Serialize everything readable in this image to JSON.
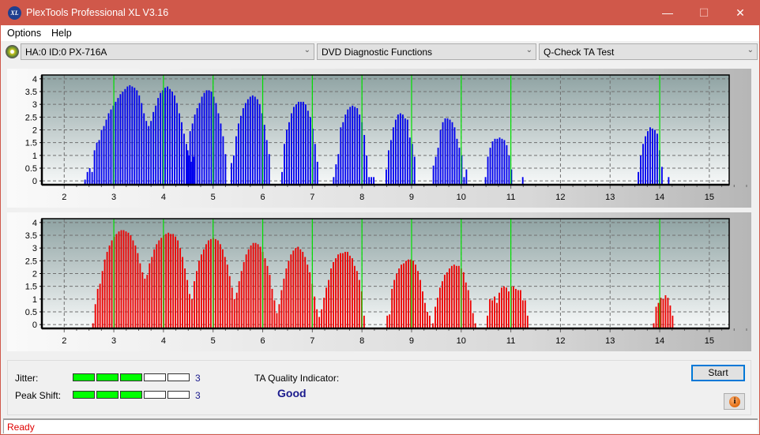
{
  "window": {
    "title": "PlexTools Professional XL V3.16",
    "logo_text": "XL",
    "controls": {
      "minimize": "—",
      "maximize": "☐",
      "close": "✕"
    }
  },
  "menu": {
    "items": [
      "Options",
      "Help"
    ]
  },
  "toolbar": {
    "drive_select": "HA:0 ID:0  PX-716A",
    "function_select": "DVD Diagnostic Functions",
    "test_select": "Q-Check TA Test"
  },
  "colors": {
    "titlebar": "#d0584a",
    "top_bars": "#0000ee",
    "bottom_bars": "#ee0000",
    "green_lines": "#00e000",
    "meter_on": "#00ff00",
    "indicator_text": "#1a1a8c",
    "status_text": "#e00000"
  },
  "chart_data": [
    {
      "name": "top-chart",
      "type": "bar",
      "xlim": [
        1.55,
        15.4
      ],
      "ylim": [
        -0.15,
        4.15
      ],
      "xticks": [
        2,
        3,
        4,
        5,
        6,
        7,
        8,
        9,
        10,
        11,
        12,
        13,
        14,
        15
      ],
      "yticks": [
        0,
        0.5,
        1,
        1.5,
        2,
        2.5,
        3,
        3.5,
        4
      ],
      "ytick_labels": [
        "0",
        "0.5",
        "1",
        "1.5",
        "2",
        "2.5",
        "3",
        "3.5",
        "4"
      ],
      "green_lines": [
        3,
        4,
        5,
        6,
        7,
        8,
        9,
        10,
        11,
        14
      ],
      "grid": true,
      "bar_color": "#0000ee",
      "bar_step": 0.0475,
      "peaks": [
        {
          "start": 2.42,
          "values": [
            0.05,
            0.35,
            0.5,
            0.35,
            1.2,
            1.5,
            1.6,
            2.0,
            2.15,
            2.4,
            2.65,
            2.8,
            2.95,
            3.1,
            3.25,
            3.4,
            3.5,
            3.6,
            3.7,
            3.75,
            3.7,
            3.65,
            3.55,
            3.35,
            3.05,
            2.65,
            2.35,
            2.15,
            2.35,
            2.7,
            2.95,
            3.25,
            3.45,
            3.55,
            3.65,
            3.7,
            3.6,
            3.5,
            3.35,
            3.05,
            2.65,
            2.3,
            1.85,
            1.45,
            1.0,
            0.75,
            0.95
          ]
        },
        {
          "start": 4.49,
          "values": [
            1.2,
            1.95,
            2.25,
            2.6,
            2.85,
            3.05,
            3.3,
            3.45,
            3.55,
            3.55,
            3.5,
            3.3,
            3.05,
            2.65,
            2.25,
            1.75,
            1.05
          ]
        },
        {
          "start": 5.37,
          "values": [
            0.7,
            1.0,
            1.75,
            2.25,
            2.55,
            2.85,
            3.05,
            3.2,
            3.3,
            3.35,
            3.3,
            3.2,
            3.0,
            2.65,
            2.2,
            1.6,
            1.05
          ]
        },
        {
          "start": 6.39,
          "values": [
            0.35,
            1.45,
            2.0,
            2.3,
            2.65,
            2.9,
            3.0,
            3.1,
            3.1,
            3.1,
            3.0,
            2.75,
            2.5,
            2.05,
            1.45,
            0.75
          ]
        },
        {
          "start": 7.43,
          "values": [
            0.15,
            0.65,
            1.05,
            2.1,
            2.3,
            2.6,
            2.8,
            2.9,
            2.95,
            2.9,
            2.85,
            2.6,
            2.3,
            1.8,
            1.0,
            0.15,
            0.15,
            0.15
          ]
        },
        {
          "start": 8.49,
          "values": [
            0.45,
            1.2,
            1.6,
            2.1,
            2.4,
            2.6,
            2.65,
            2.6,
            2.45,
            2.4,
            1.7,
            1.45,
            0.95
          ]
        },
        {
          "start": 9.44,
          "values": [
            0.6,
            0.95,
            1.3,
            2.0,
            2.3,
            2.45,
            2.45,
            2.4,
            2.3,
            2.1,
            1.65,
            1.3,
            1.0,
            0.15,
            0.45
          ]
        },
        {
          "start": 10.49,
          "values": [
            0.15,
            0.95,
            1.3,
            1.55,
            1.65,
            1.65,
            1.7,
            1.65,
            1.6,
            1.4,
            1.0,
            0.45
          ]
        },
        {
          "start": 11.24,
          "values": [
            0.15
          ]
        },
        {
          "start": 13.57,
          "values": [
            0.35,
            1.0,
            1.45,
            1.75,
            1.95,
            2.1,
            2.05,
            2.0,
            1.85,
            1.2,
            0.55
          ]
        },
        {
          "start": 14.18,
          "values": [
            0.15
          ]
        }
      ]
    },
    {
      "name": "bottom-chart",
      "type": "bar",
      "xlim": [
        1.55,
        15.4
      ],
      "ylim": [
        -0.15,
        4.15
      ],
      "xticks": [
        2,
        3,
        4,
        5,
        6,
        7,
        8,
        9,
        10,
        11,
        12,
        13,
        14,
        15
      ],
      "yticks": [
        0,
        0.5,
        1,
        1.5,
        2,
        2.5,
        3,
        3.5,
        4
      ],
      "ytick_labels": [
        "0",
        "0.5",
        "1",
        "1.5",
        "2",
        "2.5",
        "3",
        "3.5",
        "4"
      ],
      "green_lines": [
        3,
        4,
        5,
        6,
        7,
        8,
        9,
        10,
        11,
        14
      ],
      "grid": true,
      "bar_color": "#ee0000",
      "bar_step": 0.0475,
      "peaks": [
        {
          "start": 2.58,
          "values": [
            0.05,
            0.8,
            1.4,
            1.6,
            2.1,
            2.55,
            2.85,
            3.1,
            3.3,
            3.45,
            3.55,
            3.65,
            3.7,
            3.7,
            3.65,
            3.6,
            3.5,
            3.3,
            3.1,
            2.8,
            2.4,
            2.05,
            1.8,
            1.95,
            2.4,
            2.65,
            2.95,
            3.15,
            3.3,
            3.4,
            3.5,
            3.55,
            3.6,
            3.55,
            3.55,
            3.45,
            3.3,
            3.0,
            2.65,
            2.2,
            1.75,
            1.2,
            1.0,
            1.7,
            2.1,
            2.5,
            2.75,
            2.95,
            3.15,
            3.3,
            3.35,
            3.4,
            3.35,
            3.3,
            3.15,
            2.95,
            2.65,
            2.35,
            1.9,
            1.45,
            1.0,
            1.25,
            1.7,
            2.1,
            2.45,
            2.75,
            2.95,
            3.1,
            3.2,
            3.2,
            3.15,
            3.05,
            2.85,
            2.6,
            2.3,
            1.95,
            1.4,
            0.95,
            0.45,
            0.8,
            1.35,
            1.8,
            2.2,
            2.5,
            2.75,
            2.9,
            3.0,
            3.05,
            2.95,
            2.85,
            2.65,
            2.35,
            2.05,
            1.6,
            1.1,
            0.6,
            0.3,
            0.6,
            1.05,
            1.45,
            1.75,
            2.2,
            2.45,
            2.6,
            2.75,
            2.8,
            2.8,
            2.85,
            2.85,
            2.7,
            2.6,
            2.3,
            2.1,
            1.75,
            1.3,
            0.35
          ]
        },
        {
          "start": 8.51,
          "values": [
            0.35,
            0.4,
            1.4,
            1.75,
            2.0,
            2.2,
            2.35,
            2.4,
            2.5,
            2.55,
            2.55,
            2.5,
            2.35,
            2.1,
            1.75,
            1.3,
            0.85,
            0.5,
            0.35
          ]
        },
        {
          "start": 9.43,
          "values": [
            0.05,
            0.7,
            1.05,
            1.45,
            1.7,
            1.95,
            2.05,
            2.2,
            2.3,
            2.35,
            2.3,
            2.3,
            2.2,
            2.05,
            1.65,
            1.35,
            0.95,
            0.45,
            0.05
          ]
        },
        {
          "start": 10.53,
          "values": [
            0.35,
            1.0,
            0.95,
            1.1,
            0.85,
            1.25,
            1.45,
            1.5,
            1.45,
            1.3,
            1.5,
            1.5,
            1.4,
            1.35,
            1.35,
            0.95,
            0.95,
            0.35
          ]
        },
        {
          "start": 13.88,
          "values": [
            0.05,
            0.7,
            0.85,
            1.05,
            1.0,
            1.15,
            1.05,
            0.75,
            0.35
          ]
        }
      ]
    }
  ],
  "results": {
    "jitter_label": "Jitter:",
    "jitter_value": "3",
    "jitter_level": 3,
    "peak_shift_label": "Peak Shift:",
    "peak_shift_value": "3",
    "peak_shift_level": 3,
    "meter_segments": 5,
    "ta_quality_label": "TA Quality Indicator:",
    "ta_quality_value": "Good"
  },
  "buttons": {
    "start": "Start",
    "info": "i"
  },
  "status": {
    "text": "Ready"
  }
}
